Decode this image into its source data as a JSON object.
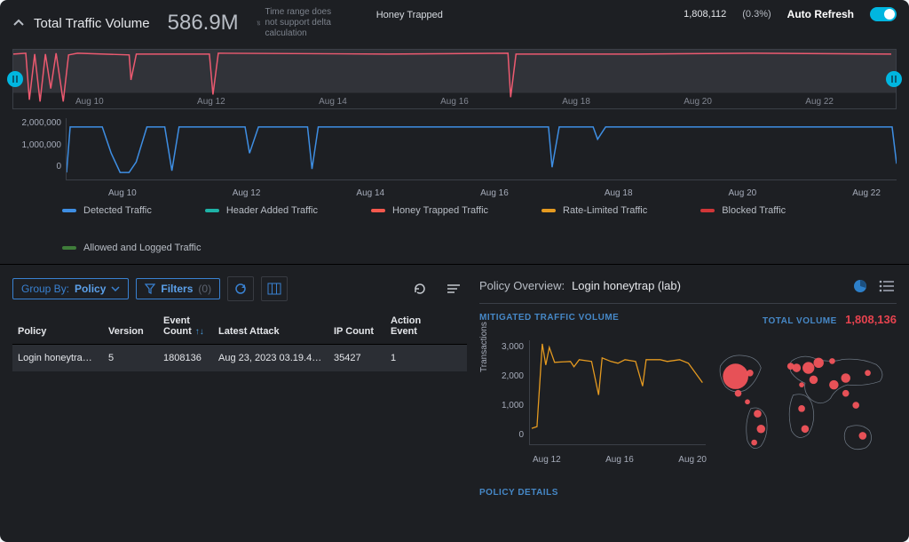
{
  "header": {
    "chevron": "collapse",
    "total_label": "Total Traffic Volume",
    "total_value": "586.9M",
    "delta_msg": "Time range does not support delta calculation",
    "honey_label": "Honey Trapped",
    "honey_count": "1,808,112",
    "honey_pct": "(0.3%)",
    "auto_refresh_label": "Auto Refresh",
    "auto_refresh_on": true
  },
  "mini_chart": {
    "x_ticks": [
      "Aug 10",
      "Aug 12",
      "Aug 14",
      "Aug 16",
      "Aug 18",
      "Aug 20",
      "Aug 22"
    ]
  },
  "main_chart": {
    "y_ticks": [
      "2,000,000",
      "1,000,000",
      "0"
    ],
    "x_ticks": [
      "Aug 10",
      "Aug 12",
      "Aug 14",
      "Aug 16",
      "Aug 18",
      "Aug 20",
      "Aug 22"
    ]
  },
  "legend": [
    {
      "label": "Detected Traffic",
      "color": "#3E8EE3"
    },
    {
      "label": "Header Added Traffic",
      "color": "#1EB2A6"
    },
    {
      "label": "Honey Trapped Traffic",
      "color": "#F5584D"
    },
    {
      "label": "Rate-Limited Traffic",
      "color": "#E59A20"
    },
    {
      "label": "Blocked Traffic",
      "color": "#D03638"
    },
    {
      "label": "Allowed and Logged Traffic",
      "color": "#3F7D3A"
    }
  ],
  "table": {
    "group_by_label": "Group By:",
    "group_by_value": "Policy",
    "filters_label": "Filters",
    "filters_count": "(0)",
    "columns": {
      "policy": "Policy",
      "version": "Version",
      "event_count": "Event Count",
      "latest": "Latest Attack",
      "ip": "IP Count",
      "action": "Action Event"
    },
    "rows": [
      {
        "policy": "Login honeytra…",
        "version": "5",
        "event_count": "1808136",
        "latest": "Aug 23, 2023 03.19.4…",
        "ip": "35427",
        "action": "1"
      }
    ]
  },
  "overview": {
    "title": "Policy Overview:",
    "name": "Login honeytrap (lab)",
    "mitigated_label": "MITIGATED TRAFFIC VOLUME",
    "total_label": "TOTAL VOLUME",
    "total_value": "1,808,136",
    "y_ticks": [
      "3,000",
      "2,000",
      "1,000",
      "0"
    ],
    "y_title": "Transactions",
    "x_ticks": [
      "Aug 12",
      "Aug 16",
      "Aug 20"
    ],
    "details_label": "POLICY DETAILS"
  },
  "chart_data": {
    "mini": {
      "type": "line",
      "x": [
        "Aug 9",
        "Aug 10",
        "Aug 11",
        "Aug 12",
        "Aug 13",
        "Aug 14",
        "Aug 15",
        "Aug 16",
        "Aug 17",
        "Aug 18",
        "Aug 19",
        "Aug 20",
        "Aug 21",
        "Aug 22",
        "Aug 23"
      ],
      "series": [
        {
          "name": "Honey Trapped",
          "color": "#EC5A70",
          "ylim": [
            0,
            100
          ],
          "values": [
            95,
            40,
            92,
            98,
            55,
            98,
            97,
            92,
            98,
            97,
            98,
            98,
            97,
            98,
            98
          ]
        }
      ]
    },
    "main": {
      "type": "line",
      "x": [
        "Aug 9",
        "Aug 10",
        "Aug 11",
        "Aug 12",
        "Aug 13",
        "Aug 14",
        "Aug 15",
        "Aug 16",
        "Aug 17",
        "Aug 18",
        "Aug 19",
        "Aug 20",
        "Aug 21",
        "Aug 22",
        "Aug 23"
      ],
      "ylim": [
        0,
        2000000
      ],
      "ylabel": "",
      "series": [
        {
          "name": "Detected Traffic",
          "color": "#3E8EE3",
          "values": [
            1750000,
            800000,
            300000,
            1700000,
            1750000,
            800000,
            1750000,
            1700000,
            1750000,
            500000,
            1700000,
            1750000,
            1750000,
            1700000,
            1750000
          ]
        }
      ]
    },
    "overview_mini": {
      "type": "line",
      "color": "#E59A20",
      "x": [
        "Aug 10",
        "Aug 11",
        "Aug 12",
        "Aug 13",
        "Aug 14",
        "Aug 15",
        "Aug 16",
        "Aug 17",
        "Aug 18",
        "Aug 19",
        "Aug 20",
        "Aug 21",
        "Aug 22"
      ],
      "ylim": [
        0,
        3000
      ],
      "ylabel": "Transactions",
      "values": [
        500,
        2900,
        2500,
        2500,
        2700,
        1500,
        2600,
        2550,
        2600,
        2000,
        2650,
        2600,
        2300
      ]
    },
    "overview_map": {
      "type": "bubble-map",
      "color": "#F2545B",
      "points": [
        {
          "region": "North America",
          "lon": -100,
          "lat": 40,
          "size": 36
        },
        {
          "region": "US East",
          "lon": -78,
          "lat": 38,
          "size": 10
        },
        {
          "region": "Mexico",
          "lon": -102,
          "lat": 22,
          "size": 8
        },
        {
          "region": "Central America",
          "lon": -85,
          "lat": 12,
          "size": 6
        },
        {
          "region": "South America N",
          "lon": -60,
          "lat": 5,
          "size": 9
        },
        {
          "region": "Brazil",
          "lon": -50,
          "lat": -12,
          "size": 11
        },
        {
          "region": "Argentina",
          "lon": -62,
          "lat": -32,
          "size": 7
        },
        {
          "region": "W Europe",
          "lon": 2,
          "lat": 48,
          "size": 13
        },
        {
          "region": "UK",
          "lon": -2,
          "lat": 53,
          "size": 9
        },
        {
          "region": "E Europe",
          "lon": 24,
          "lat": 50,
          "size": 16
        },
        {
          "region": "Russia W",
          "lon": 40,
          "lat": 55,
          "size": 14
        },
        {
          "region": "Russia C",
          "lon": 70,
          "lat": 58,
          "size": 7
        },
        {
          "region": "Middle East",
          "lon": 45,
          "lat": 30,
          "size": 11
        },
        {
          "region": "N Africa",
          "lon": 10,
          "lat": 28,
          "size": 6
        },
        {
          "region": "C Africa",
          "lon": 20,
          "lat": 5,
          "size": 8
        },
        {
          "region": "S Africa",
          "lon": 24,
          "lat": -28,
          "size": 9
        },
        {
          "region": "India",
          "lon": 78,
          "lat": 22,
          "size": 12
        },
        {
          "region": "China",
          "lon": 105,
          "lat": 34,
          "size": 12
        },
        {
          "region": "SE Asia",
          "lon": 102,
          "lat": 12,
          "size": 9
        },
        {
          "region": "Indonesia",
          "lon": 115,
          "lat": -4,
          "size": 8
        },
        {
          "region": "Japan",
          "lon": 138,
          "lat": 36,
          "size": 7
        },
        {
          "region": "Australia",
          "lon": 134,
          "lat": -25,
          "size": 9
        }
      ]
    }
  }
}
